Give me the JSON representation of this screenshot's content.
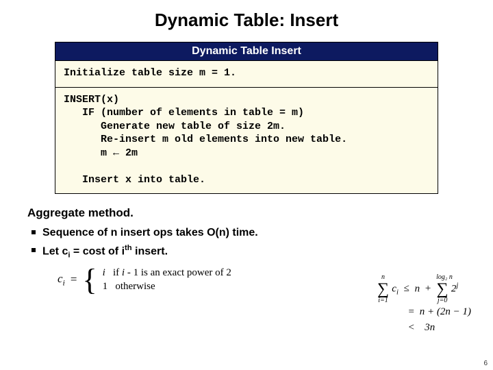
{
  "title": "Dynamic Table:  Insert",
  "algo": {
    "header": "Dynamic Table Insert",
    "init": "Initialize table size m = 1.",
    "body": "INSERT(x)\n   IF (number of elements in table = m)\n      Generate new table of size 2m.\n      Re-insert m old elements into new table.\n      m ← 2m\n\n   Insert x into table."
  },
  "section_head": "Aggregate method.",
  "bullets": {
    "b1_a": "Sequence of n insert ops takes O(n) time.",
    "b2_a": "Let c",
    "b2_b": " = cost of i",
    "b2_c": " insert."
  },
  "ci": {
    "lhs": "c",
    "sub": "i",
    "eq": "=",
    "case1_a": "i",
    "case1_b": "if ",
    "case1_c": "i",
    "case1_d": " - 1 is an exact power of 2",
    "case2_a": "1",
    "case2_b": "otherwise"
  },
  "sum": {
    "r1_a": "c",
    "r1_b": "n",
    "r1_c": "2",
    "r2": "n + (2n − 1)",
    "r3": "3n",
    "lim1_top": "n",
    "lim1_bot": "i=1",
    "lim2_top": "log₂ n",
    "lim2_bot": "j=0",
    "sigma": "∑",
    "le": "≤",
    "lt": "<",
    "eq": "=",
    "plus": "+",
    "j": "j",
    "i": "i"
  },
  "pagenum": "6"
}
